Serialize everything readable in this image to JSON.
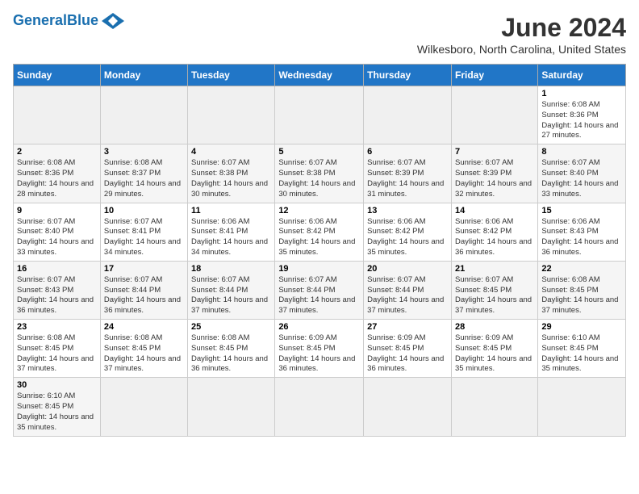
{
  "header": {
    "logo_general": "General",
    "logo_blue": "Blue",
    "title": "June 2024",
    "subtitle": "Wilkesboro, North Carolina, United States"
  },
  "days_of_week": [
    "Sunday",
    "Monday",
    "Tuesday",
    "Wednesday",
    "Thursday",
    "Friday",
    "Saturday"
  ],
  "weeks": [
    [
      {
        "day": "",
        "empty": true
      },
      {
        "day": "",
        "empty": true
      },
      {
        "day": "",
        "empty": true
      },
      {
        "day": "",
        "empty": true
      },
      {
        "day": "",
        "empty": true
      },
      {
        "day": "",
        "empty": true
      },
      {
        "day": "1",
        "sunrise": "Sunrise: 6:08 AM",
        "sunset": "Sunset: 8:36 PM",
        "daylight": "Daylight: 14 hours and 27 minutes."
      }
    ],
    [
      {
        "day": "2",
        "sunrise": "Sunrise: 6:08 AM",
        "sunset": "Sunset: 8:36 PM",
        "daylight": "Daylight: 14 hours and 28 minutes."
      },
      {
        "day": "3",
        "sunrise": "Sunrise: 6:08 AM",
        "sunset": "Sunset: 8:37 PM",
        "daylight": "Daylight: 14 hours and 29 minutes."
      },
      {
        "day": "4",
        "sunrise": "Sunrise: 6:07 AM",
        "sunset": "Sunset: 8:38 PM",
        "daylight": "Daylight: 14 hours and 30 minutes."
      },
      {
        "day": "5",
        "sunrise": "Sunrise: 6:07 AM",
        "sunset": "Sunset: 8:38 PM",
        "daylight": "Daylight: 14 hours and 30 minutes."
      },
      {
        "day": "6",
        "sunrise": "Sunrise: 6:07 AM",
        "sunset": "Sunset: 8:39 PM",
        "daylight": "Daylight: 14 hours and 31 minutes."
      },
      {
        "day": "7",
        "sunrise": "Sunrise: 6:07 AM",
        "sunset": "Sunset: 8:39 PM",
        "daylight": "Daylight: 14 hours and 32 minutes."
      },
      {
        "day": "8",
        "sunrise": "Sunrise: 6:07 AM",
        "sunset": "Sunset: 8:40 PM",
        "daylight": "Daylight: 14 hours and 33 minutes."
      }
    ],
    [
      {
        "day": "9",
        "sunrise": "Sunrise: 6:07 AM",
        "sunset": "Sunset: 8:40 PM",
        "daylight": "Daylight: 14 hours and 33 minutes."
      },
      {
        "day": "10",
        "sunrise": "Sunrise: 6:07 AM",
        "sunset": "Sunset: 8:41 PM",
        "daylight": "Daylight: 14 hours and 34 minutes."
      },
      {
        "day": "11",
        "sunrise": "Sunrise: 6:06 AM",
        "sunset": "Sunset: 8:41 PM",
        "daylight": "Daylight: 14 hours and 34 minutes."
      },
      {
        "day": "12",
        "sunrise": "Sunrise: 6:06 AM",
        "sunset": "Sunset: 8:42 PM",
        "daylight": "Daylight: 14 hours and 35 minutes."
      },
      {
        "day": "13",
        "sunrise": "Sunrise: 6:06 AM",
        "sunset": "Sunset: 8:42 PM",
        "daylight": "Daylight: 14 hours and 35 minutes."
      },
      {
        "day": "14",
        "sunrise": "Sunrise: 6:06 AM",
        "sunset": "Sunset: 8:42 PM",
        "daylight": "Daylight: 14 hours and 36 minutes."
      },
      {
        "day": "15",
        "sunrise": "Sunrise: 6:06 AM",
        "sunset": "Sunset: 8:43 PM",
        "daylight": "Daylight: 14 hours and 36 minutes."
      }
    ],
    [
      {
        "day": "16",
        "sunrise": "Sunrise: 6:07 AM",
        "sunset": "Sunset: 8:43 PM",
        "daylight": "Daylight: 14 hours and 36 minutes."
      },
      {
        "day": "17",
        "sunrise": "Sunrise: 6:07 AM",
        "sunset": "Sunset: 8:44 PM",
        "daylight": "Daylight: 14 hours and 36 minutes."
      },
      {
        "day": "18",
        "sunrise": "Sunrise: 6:07 AM",
        "sunset": "Sunset: 8:44 PM",
        "daylight": "Daylight: 14 hours and 37 minutes."
      },
      {
        "day": "19",
        "sunrise": "Sunrise: 6:07 AM",
        "sunset": "Sunset: 8:44 PM",
        "daylight": "Daylight: 14 hours and 37 minutes."
      },
      {
        "day": "20",
        "sunrise": "Sunrise: 6:07 AM",
        "sunset": "Sunset: 8:44 PM",
        "daylight": "Daylight: 14 hours and 37 minutes."
      },
      {
        "day": "21",
        "sunrise": "Sunrise: 6:07 AM",
        "sunset": "Sunset: 8:45 PM",
        "daylight": "Daylight: 14 hours and 37 minutes."
      },
      {
        "day": "22",
        "sunrise": "Sunrise: 6:08 AM",
        "sunset": "Sunset: 8:45 PM",
        "daylight": "Daylight: 14 hours and 37 minutes."
      }
    ],
    [
      {
        "day": "23",
        "sunrise": "Sunrise: 6:08 AM",
        "sunset": "Sunset: 8:45 PM",
        "daylight": "Daylight: 14 hours and 37 minutes."
      },
      {
        "day": "24",
        "sunrise": "Sunrise: 6:08 AM",
        "sunset": "Sunset: 8:45 PM",
        "daylight": "Daylight: 14 hours and 37 minutes."
      },
      {
        "day": "25",
        "sunrise": "Sunrise: 6:08 AM",
        "sunset": "Sunset: 8:45 PM",
        "daylight": "Daylight: 14 hours and 36 minutes."
      },
      {
        "day": "26",
        "sunrise": "Sunrise: 6:09 AM",
        "sunset": "Sunset: 8:45 PM",
        "daylight": "Daylight: 14 hours and 36 minutes."
      },
      {
        "day": "27",
        "sunrise": "Sunrise: 6:09 AM",
        "sunset": "Sunset: 8:45 PM",
        "daylight": "Daylight: 14 hours and 36 minutes."
      },
      {
        "day": "28",
        "sunrise": "Sunrise: 6:09 AM",
        "sunset": "Sunset: 8:45 PM",
        "daylight": "Daylight: 14 hours and 35 minutes."
      },
      {
        "day": "29",
        "sunrise": "Sunrise: 6:10 AM",
        "sunset": "Sunset: 8:45 PM",
        "daylight": "Daylight: 14 hours and 35 minutes."
      }
    ],
    [
      {
        "day": "30",
        "sunrise": "Sunrise: 6:10 AM",
        "sunset": "Sunset: 8:45 PM",
        "daylight": "Daylight: 14 hours and 35 minutes."
      },
      {
        "day": "",
        "empty": true
      },
      {
        "day": "",
        "empty": true
      },
      {
        "day": "",
        "empty": true
      },
      {
        "day": "",
        "empty": true
      },
      {
        "day": "",
        "empty": true
      },
      {
        "day": "",
        "empty": true
      }
    ]
  ]
}
